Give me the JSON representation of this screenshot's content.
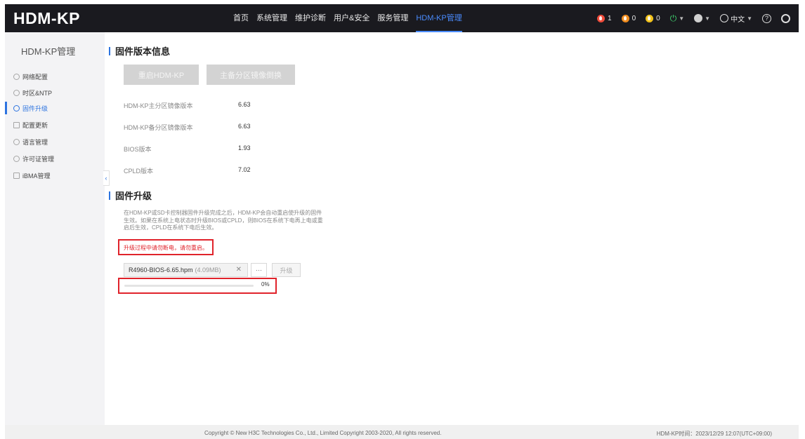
{
  "header": {
    "logo": "HDM-KP",
    "nav": [
      {
        "label": "首页",
        "active": false
      },
      {
        "label": "系统管理",
        "active": false
      },
      {
        "label": "维护诊断",
        "active": false
      },
      {
        "label": "用户&安全",
        "active": false
      },
      {
        "label": "服务管理",
        "active": false
      },
      {
        "label": "HDM-KP管理",
        "active": true
      }
    ],
    "alarms": {
      "critical": "1",
      "major": "0",
      "minor": "0"
    },
    "language": "中文"
  },
  "sidebar": {
    "title": "HDM-KP管理",
    "items": [
      {
        "label": "网络配置",
        "active": false
      },
      {
        "label": "时区&NTP",
        "active": false
      },
      {
        "label": "固件升级",
        "active": true
      },
      {
        "label": "配置更新",
        "active": false
      },
      {
        "label": "语言管理",
        "active": false
      },
      {
        "label": "许可证管理",
        "active": false
      },
      {
        "label": "iBMA管理",
        "active": false
      }
    ]
  },
  "firmware_info": {
    "title": "固件版本信息",
    "restart_button": "重启HDM-KP",
    "switch_button": "主备分区镜像倒换",
    "rows": [
      {
        "label": "HDM-KP主分区镜像版本",
        "value": "6.63"
      },
      {
        "label": "HDM-KP备分区镜像版本",
        "value": "6.63"
      },
      {
        "label": "BIOS版本",
        "value": "1.93"
      },
      {
        "label": "CPLD版本",
        "value": "7.02"
      }
    ]
  },
  "firmware_upgrade": {
    "title": "固件升级",
    "desc_lines": [
      "在HDM-KP或SD卡控制器固件升级完成之后，HDM-KP会自动重启使升级的固件",
      "生效。如果在系统上电状态时升级BIOS或CPLD，则BIOS在系统下电再上电或重",
      "启后生效，CPLD在系统下电后生效。"
    ],
    "warning": "升级过程中请勿断电，请勿重启。",
    "file_name": "R4960-BIOS-6.65.hpm",
    "file_size": "(4.09MB)",
    "more_label": "···",
    "upgrade_button": "升级",
    "progress_value": 0,
    "progress_text": "0%"
  },
  "footer": {
    "copyright": "Copyright © New H3C Technologies Co., Ltd., Limited Copyright 2003-2020, All rights reserved.",
    "time": "HDM-KP时间：2023/12/29 12:07(UTC+09:00)"
  },
  "colors": {
    "accent": "#2d74e0",
    "warning": "#e0232b",
    "header_bg": "#1a1a1f"
  }
}
